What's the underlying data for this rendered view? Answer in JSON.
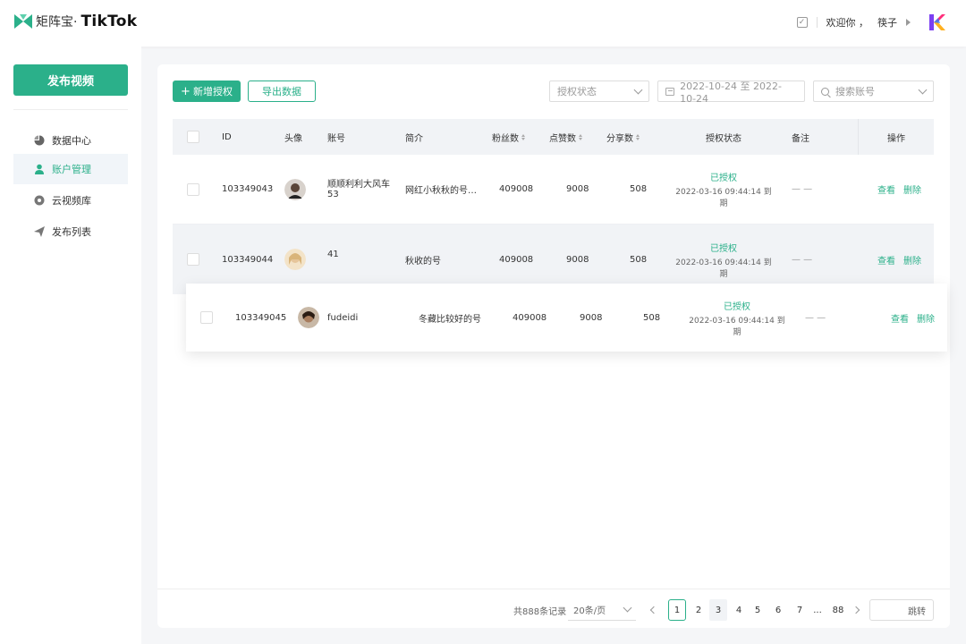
{
  "header": {
    "logo_cn": "矩阵宝·",
    "logo_brand": "TikTok",
    "welcome": "欢迎你 ，",
    "username": "筷子"
  },
  "sidebar": {
    "publish_label": "发布视频",
    "items": [
      {
        "label": "数据中心",
        "icon": "pie-chart-icon",
        "active": false
      },
      {
        "label": "账户管理",
        "icon": "user-icon",
        "active": true
      },
      {
        "label": "云视频库",
        "icon": "cloud-video-icon",
        "active": false
      },
      {
        "label": "发布列表",
        "icon": "send-icon",
        "active": false
      }
    ]
  },
  "toolbar": {
    "add_label": "新增授权",
    "export_label": "导出数据",
    "status_placeholder": "授权状态",
    "date_range": "2022-10-24 至 2022-10-24",
    "search_placeholder": "搜索账号"
  },
  "table": {
    "headers": {
      "id": "ID",
      "avatar": "头像",
      "account": "账号",
      "intro": "简介",
      "fans": "粉丝数",
      "likes": "点赞数",
      "shares": "分享数",
      "auth_status": "授权状态",
      "remark": "备注",
      "ops": "操作"
    },
    "rows": [
      {
        "id": "103349043",
        "account_line1": "顺顺利利大风车",
        "account_line2": "53",
        "intro": "网红小秋秋的号…",
        "fans": "409008",
        "likes": "9008",
        "shares": "508",
        "status": "已授权",
        "expire": "2022-03-16 09:44:14 到期",
        "remark": "— —",
        "view": "查看",
        "delete": "删除"
      },
      {
        "id": "103349044",
        "account_line1": "41",
        "account_line2": "",
        "intro": "秋收的号",
        "fans": "409008",
        "likes": "9008",
        "shares": "508",
        "status": "已授权",
        "expire": "2022-03-16 09:44:14 到期",
        "remark": "— —",
        "view": "查看",
        "delete": "删除"
      },
      {
        "id": "103349045",
        "account_line1": "fudeidi",
        "account_line2": "",
        "intro": "冬藏比较好的号",
        "fans": "409008",
        "likes": "9008",
        "shares": "508",
        "status": "已授权",
        "expire": "2022-03-16 09:44:14 到期",
        "remark": "— —",
        "view": "查看",
        "delete": "删除"
      }
    ]
  },
  "pagination": {
    "total": "共888条记录",
    "page_size": "20条/页",
    "pages": [
      "1",
      "2",
      "3",
      "4",
      "5",
      "6",
      "7"
    ],
    "ellipsis": "...",
    "last": "88",
    "current": "1",
    "jump_label": "跳转"
  },
  "colors": {
    "accent": "#2bb08a",
    "background": "#f5f6f8"
  }
}
